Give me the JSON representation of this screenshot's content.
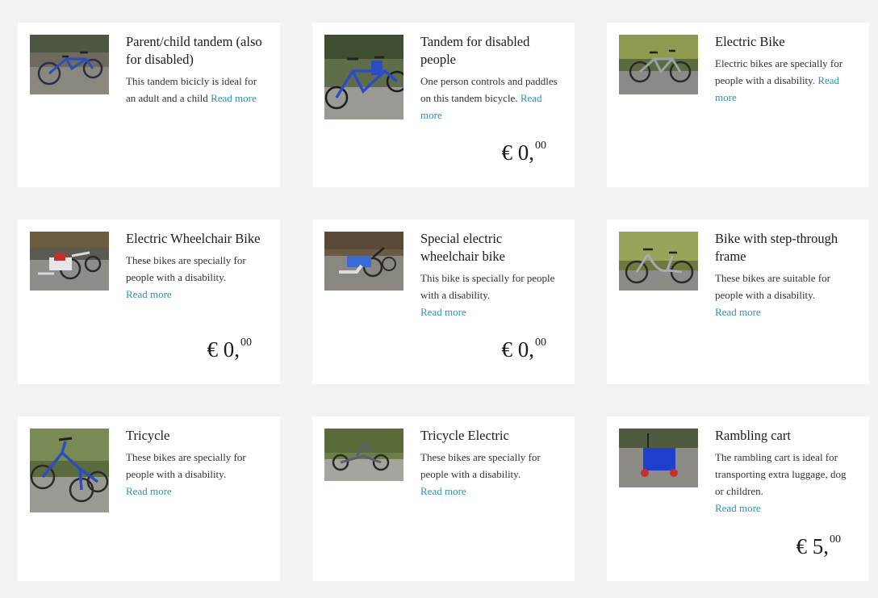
{
  "products": [
    {
      "title": "Parent/child tandem (also for disabled)",
      "desc": "This tandem bicicly is ideal for an adult and a child",
      "more": "Read more",
      "price": null,
      "image_icon": "tandem-bike-photo"
    },
    {
      "title": "Tandem for disabled people",
      "desc": "One person controls and paddles on this tandem bicycle.",
      "more": "Read more",
      "price": {
        "whole": "€ 0,",
        "cents": "00"
      },
      "image_icon": "tandem-bike-photo"
    },
    {
      "title": "Electric Bike",
      "desc": "Electric bikes are specially for people with a disability.",
      "more": "Read more",
      "price": null,
      "image_icon": "electric-bike-photo"
    },
    {
      "title": "Electric Wheelchair Bike",
      "desc": "These bikes are specially for people with a disability.",
      "more": "Read more",
      "price": {
        "whole": "€ 0,",
        "cents": "00"
      },
      "image_icon": "wheelchair-bike-photo"
    },
    {
      "title": "Special electric wheelchair bike",
      "desc": "This bike is specially for people with a disability.",
      "more": "Read more",
      "price": {
        "whole": "€ 0,",
        "cents": "00"
      },
      "image_icon": "wheelchair-bike-photo"
    },
    {
      "title": "Bike with step-through frame",
      "desc": "These bikes are suitable for people with a disability.",
      "more": "Read more",
      "price": null,
      "image_icon": "step-through-bike-photo"
    },
    {
      "title": "Tricycle",
      "desc": "These bikes are specially for people with a disability.",
      "more": "Read more",
      "price": null,
      "image_icon": "tricycle-photo"
    },
    {
      "title": "Tricycle Electric",
      "desc": "These bikes are specially for people with a disability.",
      "more": "Read more",
      "price": null,
      "image_icon": "recumbent-tricycle-photo"
    },
    {
      "title": "Rambling cart",
      "desc": "The rambling cart is ideal for transporting extra luggage, dog or children.",
      "more": "Read more",
      "price": {
        "whole": "€ 5,",
        "cents": "00"
      },
      "image_icon": "blue-cart-photo"
    }
  ],
  "colors": {
    "background": "#f2f2f2",
    "card": "#ffffff",
    "link": "#2a93b8",
    "text": "#1c1c1c"
  }
}
